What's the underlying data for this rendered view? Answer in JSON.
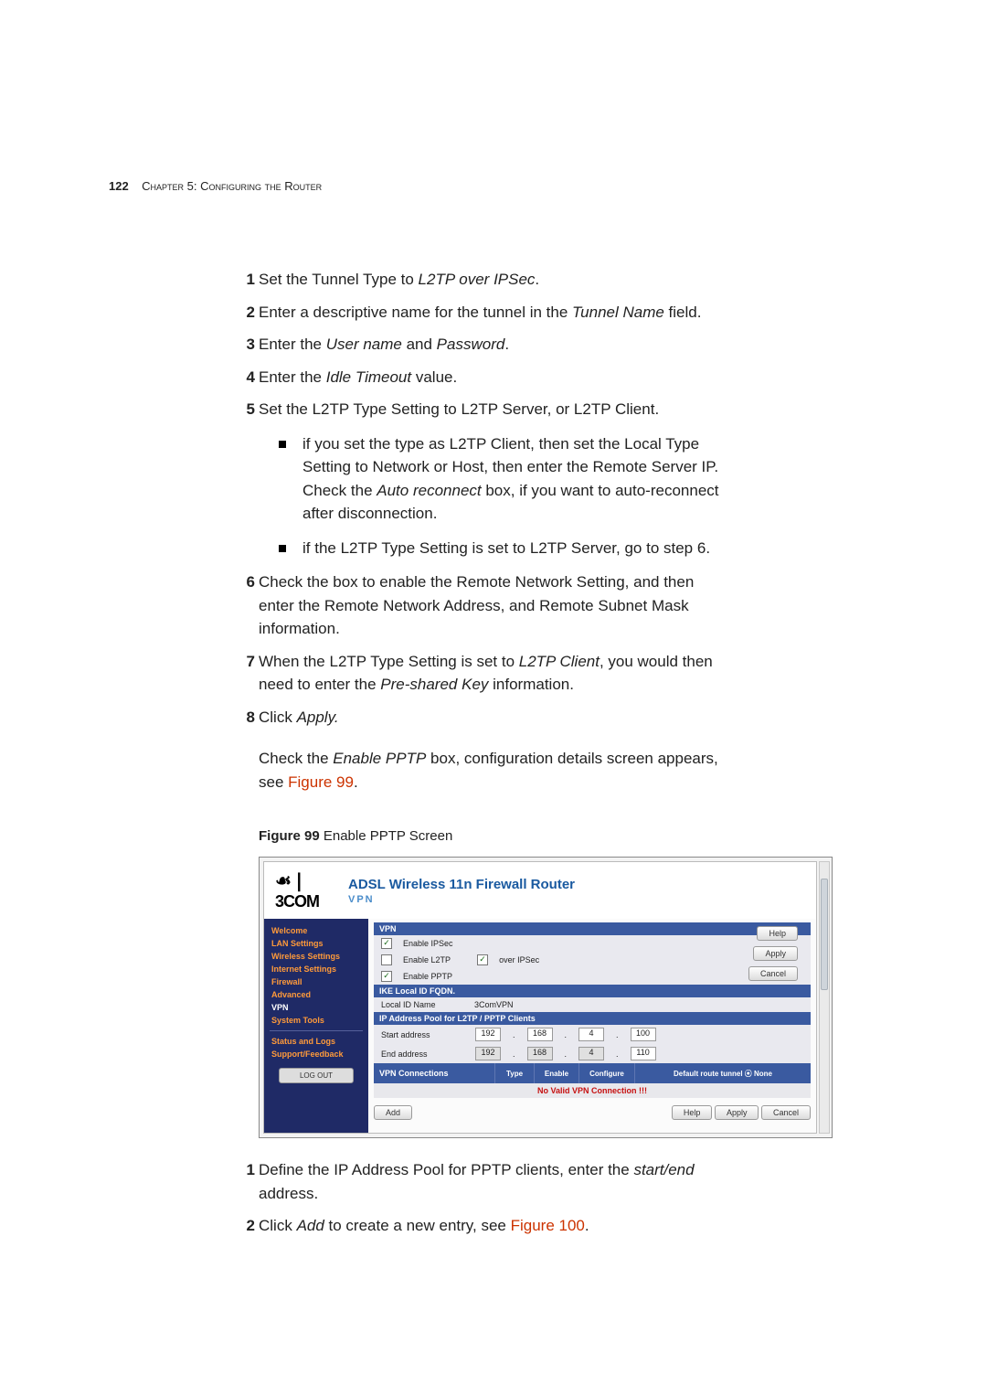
{
  "header": {
    "page_number": "122",
    "chapter": "Chapter 5: Configuring the Router"
  },
  "list1": {
    "s1": {
      "pre": "Set the Tunnel Type to ",
      "em": "L2TP over IPSec",
      "post": "."
    },
    "s2": {
      "pre": "Enter a descriptive name for the tunnel in the ",
      "em": "Tunnel Name",
      "post": " field."
    },
    "s3": {
      "pre": "Enter the ",
      "em1": "User name",
      "mid": " and ",
      "em2": "Password",
      "post": "."
    },
    "s4": {
      "pre": "Enter the ",
      "em": "Idle Timeout",
      "post": " value."
    },
    "s5": "Set the L2TP Type Setting to L2TP Server, or L2TP Client.",
    "s5a": {
      "pre": "if you set the type as L2TP Client, then set the Local Type Setting to Network or Host, then enter the Remote Server IP. Check the ",
      "em": "Auto reconnect",
      "post": " box, if you want to auto-reconnect after disconnection."
    },
    "s5b": "if the L2TP Type Setting is set to L2TP Server, go to step 6.",
    "s6": "Check the box to enable the Remote Network Setting, and then enter the Remote Network Address, and Remote Subnet Mask information.",
    "s7": {
      "pre": "When the L2TP Type Setting is set to ",
      "em1": "L2TP Client",
      "mid": ", you would then need to enter the ",
      "em2": "Pre-shared Key",
      "post": " information."
    },
    "s8": {
      "pre": "Click ",
      "em": "Apply."
    }
  },
  "para1": {
    "pre": "Check the ",
    "em": "Enable PPTP",
    "mid": " box, configuration details screen appears, see ",
    "link": "Figure 99",
    "post": "."
  },
  "figcap": {
    "b": "Figure 99",
    "rest": "   Enable PPTP Screen"
  },
  "fig": {
    "brand_glyph": "☙❘",
    "brand": "3COM",
    "title": "ADSL Wireless 11n Firewall Router",
    "subtitle": "VPN",
    "side": {
      "welcome": "Welcome",
      "lan": "LAN Settings",
      "wireless": "Wireless Settings",
      "internet": "Internet Settings",
      "firewall": "Firewall",
      "advanced": "Advanced",
      "vpn": "VPN",
      "tools": "System Tools",
      "status": "Status and Logs",
      "support": "Support/Feedback",
      "logout": "LOG OUT"
    },
    "btns": {
      "help": "Help",
      "apply": "Apply",
      "cancel": "Cancel",
      "add": "Add"
    },
    "vpn_hdr": "VPN",
    "cb_ipsec": "Enable IPSec",
    "cb_l2tp": "Enable L2TP",
    "cb_over": "over IPSec",
    "cb_pptp": "Enable PPTP",
    "ike_hdr": "IKE Local ID FQDN.",
    "ike_lbl": "Local ID Name",
    "ike_val": "3ComVPN",
    "pool_hdr": "IP Address Pool for L2TP / PPTP Clients",
    "start_lbl": "Start address",
    "end_lbl": "End address",
    "ip": {
      "a1": "192",
      "a2": "168",
      "a3": "4",
      "a4": "100",
      "b1": "192",
      "b2": "168",
      "b3": "4",
      "b4": "110"
    },
    "conn_hdr": "VPN Connections",
    "col_type": "Type",
    "col_enable": "Enable",
    "col_conf": "Configure",
    "col_def": "Default route tunnel ⦿ None",
    "noconn": "No Valid VPN Connection !!!"
  },
  "list2": {
    "s1": {
      "pre": "Define the IP Address Pool for PPTP clients, enter the ",
      "em": "start/end",
      "post": " address."
    },
    "s2": {
      "pre": "Click ",
      "em": "Add",
      "mid": " to create a new entry, see ",
      "link": "Figure 100",
      "post": "."
    }
  },
  "chart_data": {
    "type": "table",
    "title": "Enable PPTP Screen – field values",
    "rows": [
      [
        "Enable IPSec",
        "checked"
      ],
      [
        "Enable L2TP",
        "unchecked"
      ],
      [
        "over IPSec",
        "checked"
      ],
      [
        "Enable PPTP",
        "checked"
      ],
      [
        "Local ID Name",
        "3ComVPN"
      ],
      [
        "Start address",
        "192.168.4.100"
      ],
      [
        "End address",
        "192.168.4.110"
      ],
      [
        "VPN Connections",
        "No Valid VPN Connection !!!"
      ],
      [
        "Default route tunnel",
        "None"
      ]
    ]
  }
}
